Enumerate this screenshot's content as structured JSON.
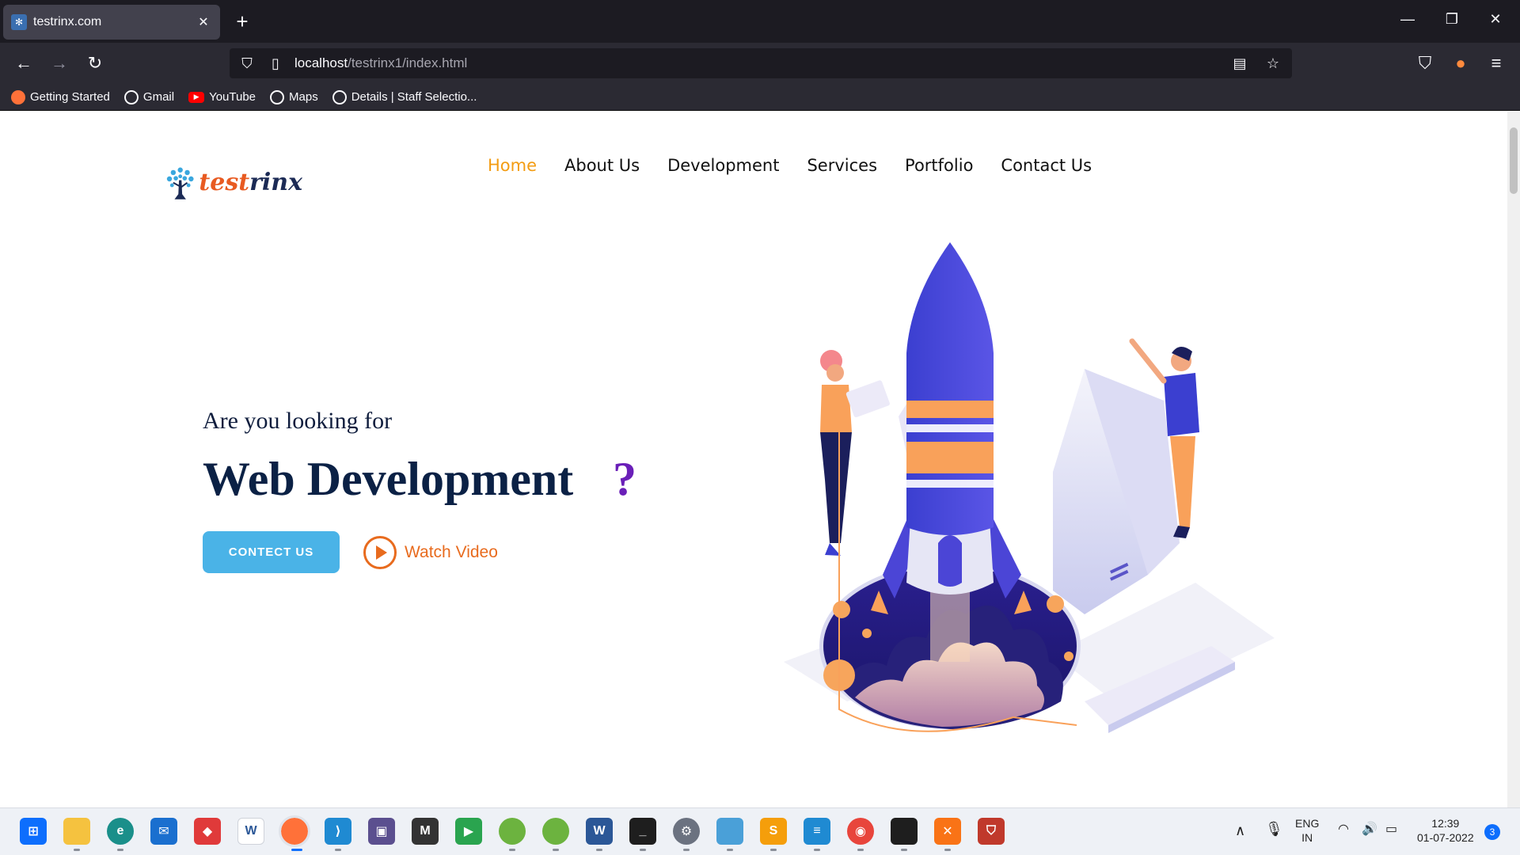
{
  "browser": {
    "tab_title": "testrinx.com",
    "tab_close": "✕",
    "new_tab": "+",
    "url_host": "localhost",
    "url_path": "/testrinx1/index.html",
    "window_controls": {
      "minimize": "—",
      "restore": "❐",
      "close": "✕"
    },
    "bookmarks": [
      {
        "label": "Getting Started",
        "icon": "firefox-icon"
      },
      {
        "label": "Gmail",
        "icon": "globe-icon"
      },
      {
        "label": "YouTube",
        "icon": "youtube-icon"
      },
      {
        "label": "Maps",
        "icon": "globe-icon"
      },
      {
        "label": "Details | Staff Selectio...",
        "icon": "globe-icon"
      }
    ]
  },
  "site": {
    "logo": {
      "part1": "test",
      "part2": "rinx"
    },
    "menu": [
      "Home",
      "About Us",
      "Development",
      "Services",
      "Portfolio",
      "Contact Us"
    ],
    "menu_active_color": "#f39c12",
    "hero": {
      "subtitle": "Are you looking for",
      "title": "Web Development",
      "question": "?",
      "cta_label": "CONTECT US",
      "watch_label": "Watch Video"
    },
    "accent": "#4ab3e7",
    "orange": "#e86b1e"
  },
  "taskbar": {
    "lang_top": "ENG",
    "lang_bottom": "IN",
    "time": "12:39",
    "date": "01-07-2022",
    "notifications": "3"
  }
}
